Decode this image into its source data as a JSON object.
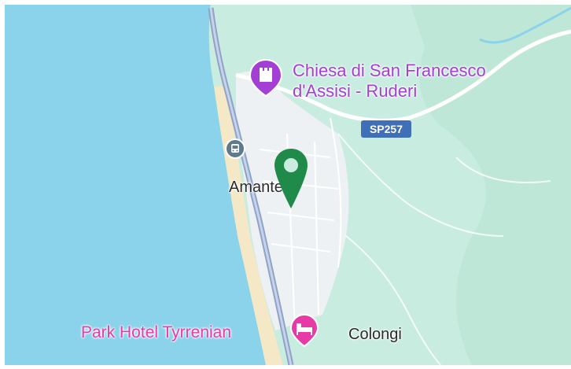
{
  "map": {
    "colors": {
      "water": "#8bd3ea",
      "land": "#c8ece0",
      "urban": "#eef1f3",
      "road": "#8fa2c8",
      "beach": "#f4e8c6",
      "poi_purple": "#a43fd6",
      "hotel_pink": "#e83aa6",
      "marker_green": "#1f8a4a"
    },
    "poi": {
      "name_line1": "Chiesa di San Francesco",
      "name_line2": "d'Assisi - Ruderi",
      "icon": "castle-icon"
    },
    "road_shield": "SP257",
    "towns": {
      "amantea": "Amantea",
      "colongi": "Colongi"
    },
    "hotel": {
      "name": "Park Hotel Tyrrenian",
      "icon": "bed-icon"
    },
    "station_icon": "train-icon",
    "marker_icon": "location-pin-icon"
  }
}
